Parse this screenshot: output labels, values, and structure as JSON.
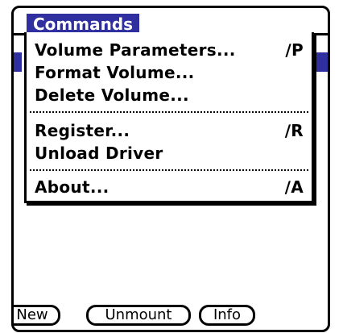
{
  "title_bar": {
    "menu_title": "Commands"
  },
  "menu": {
    "items": [
      {
        "label": "Volume Parameters...",
        "shortcut": "∕P"
      },
      {
        "label": "Format Volume...",
        "shortcut": ""
      },
      {
        "label": "Delete Volume...",
        "shortcut": ""
      },
      {
        "label": "Register...",
        "shortcut": "∕R"
      },
      {
        "label": "Unload Driver",
        "shortcut": ""
      },
      {
        "label": "About...",
        "shortcut": "∕A"
      }
    ]
  },
  "buttons": {
    "new_label": "New",
    "unmount_label": "Unmount",
    "info_label": "Info"
  },
  "colors": {
    "accent": "#2f2fa0"
  }
}
